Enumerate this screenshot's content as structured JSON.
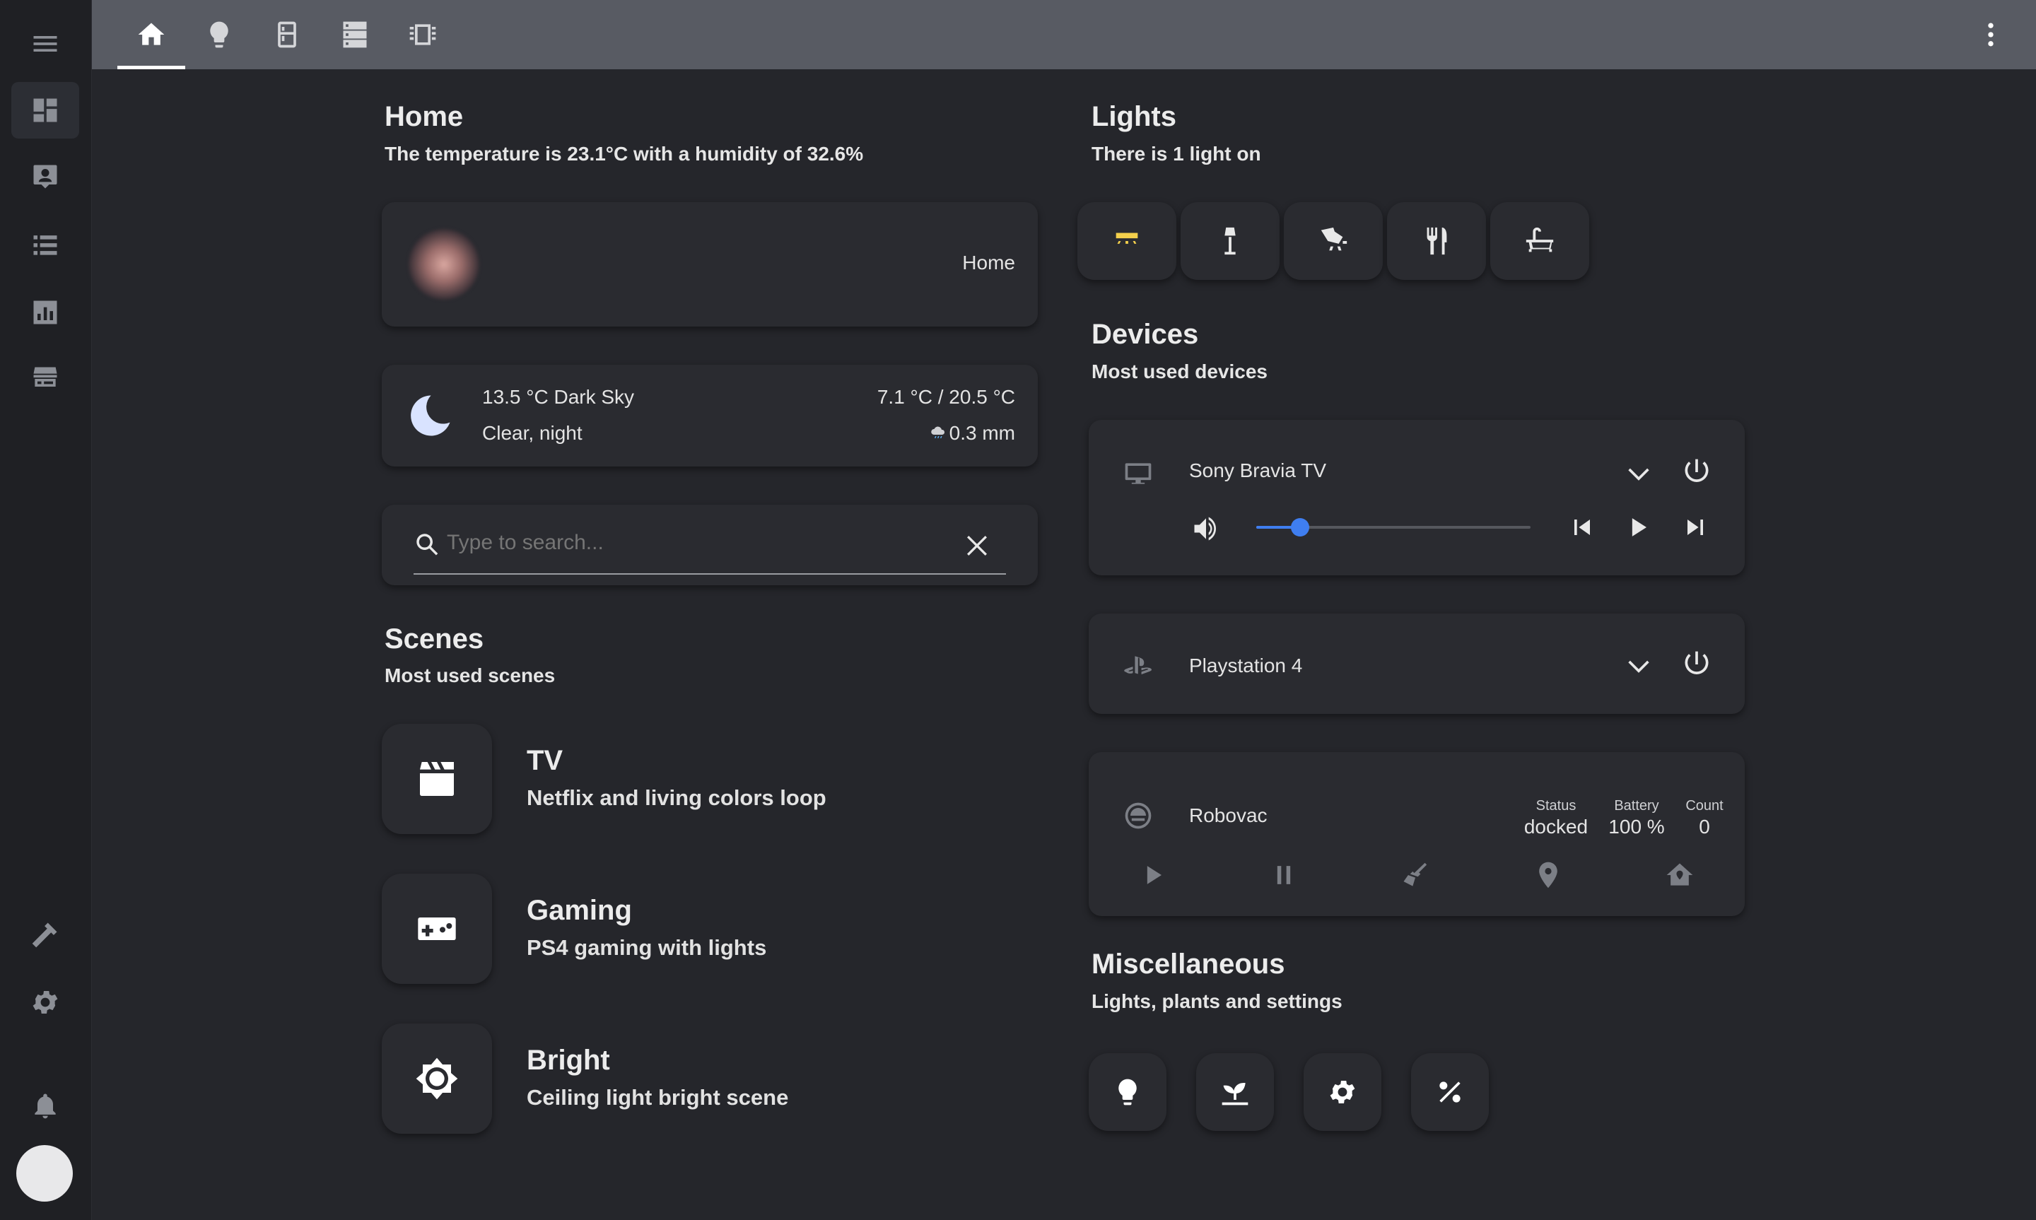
{
  "sidebar": {
    "items": [
      {
        "name": "menu-icon"
      },
      {
        "name": "dashboard-icon"
      },
      {
        "name": "person-card-icon"
      },
      {
        "name": "list-icon"
      },
      {
        "name": "chart-icon"
      },
      {
        "name": "hacs-icon",
        "label": "HACS"
      },
      {
        "name": "hammer-icon"
      },
      {
        "name": "gear-icon"
      },
      {
        "name": "bell-icon"
      }
    ]
  },
  "topbar": {
    "tabs": [
      {
        "name": "home-icon",
        "active": true
      },
      {
        "name": "lightbulb-icon"
      },
      {
        "name": "fridge-icon"
      },
      {
        "name": "server-icon"
      },
      {
        "name": "memory-icon"
      }
    ],
    "menu_icon": "dots-vertical-icon"
  },
  "home": {
    "title": "Home",
    "subtitle": "The temperature is 23.1°C with a humidity of 32.6%",
    "person_state": "Home"
  },
  "weather": {
    "icon": "moon-icon",
    "line1": "13.5 °C Dark Sky",
    "line2": "Clear, night",
    "temp_range": "7.1 °C / 20.5 °C",
    "precipitation": "0.3 mm"
  },
  "search": {
    "placeholder": "Type to search..."
  },
  "scenes": {
    "title": "Scenes",
    "subtitle": "Most used scenes",
    "items": [
      {
        "name": "TV",
        "description": "Netflix and living colors loop",
        "icon": "clapperboard-icon"
      },
      {
        "name": "Gaming",
        "description": "PS4 gaming with lights",
        "icon": "gamepad-icon"
      },
      {
        "name": "Bright",
        "description": "Ceiling light bright scene",
        "icon": "brightness-icon"
      }
    ]
  },
  "lights": {
    "title": "Lights",
    "subtitle": "There is 1 light on",
    "items": [
      {
        "icon": "ceiling-light-icon",
        "on": true
      },
      {
        "icon": "floor-lamp-icon",
        "on": false
      },
      {
        "icon": "spotlight-icon",
        "on": false
      },
      {
        "icon": "silverware-icon",
        "on": false
      },
      {
        "icon": "bathtub-icon",
        "on": false
      }
    ],
    "on_color": "#f4d04c"
  },
  "devices": {
    "title": "Devices",
    "subtitle": "Most used devices",
    "tv": {
      "name": "Sony Bravia TV",
      "volume": 0.16
    },
    "ps4": {
      "name": "Playstation 4"
    },
    "robovac": {
      "name": "Robovac",
      "stats": [
        {
          "label": "Status",
          "value": "docked"
        },
        {
          "label": "Battery",
          "value": "100 %"
        },
        {
          "label": "Count",
          "value": "0"
        }
      ]
    }
  },
  "misc": {
    "title": "Miscellaneous",
    "subtitle": "Lights, plants and settings",
    "items": [
      {
        "icon": "lightbulb-icon"
      },
      {
        "icon": "sprout-icon"
      },
      {
        "icon": "gear-icon"
      },
      {
        "icon": "percent-icon"
      }
    ]
  },
  "colors": {
    "background": "#25262b",
    "sidebar": "#1f2024",
    "topbar": "#585b63",
    "card": "#2a2b30",
    "accent": "#3f7ef0"
  }
}
